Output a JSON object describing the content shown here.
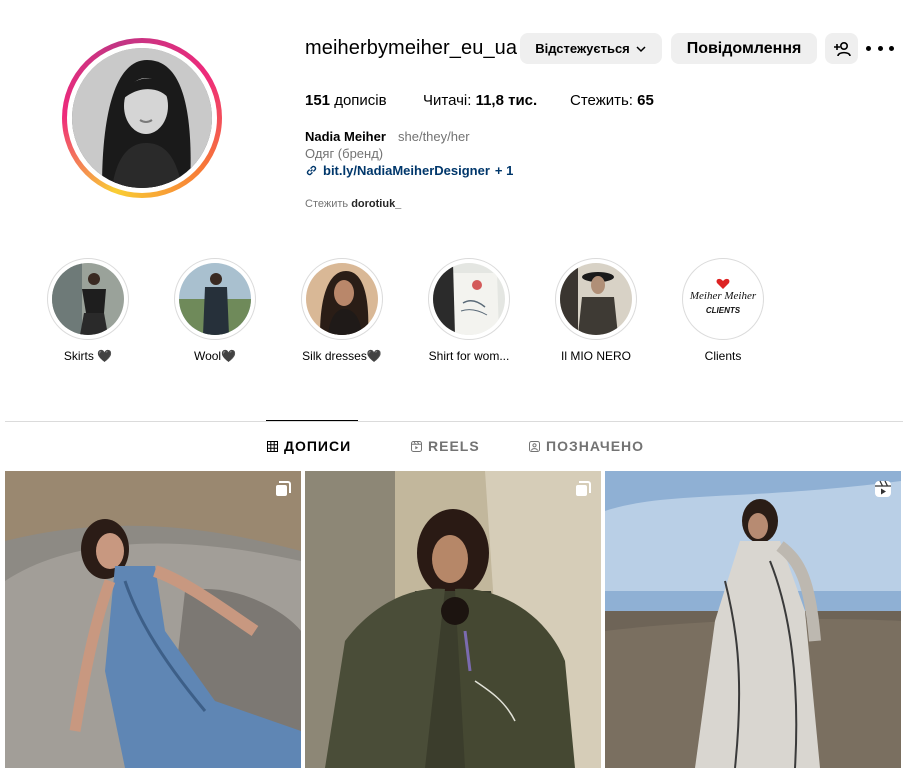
{
  "profile": {
    "username": "meiherbymeiher_eu_ua",
    "follow_button": "Відстежується",
    "message_button": "Повідомлення",
    "posts_count": "151",
    "posts_label": "дописів",
    "followers_label": "Читачі:",
    "followers_count": "11,8 тис.",
    "following_label": "Стежить:",
    "following_count": "65",
    "display_name": "Nadia Meiher",
    "pronouns": "she/they/her",
    "category": "Одяг (бренд)",
    "link_text": "bit.ly/NadiaMeiherDesigner",
    "link_extra": "+ 1",
    "followed_by_label": "Стежить",
    "followed_by_user": "dorotiuk_"
  },
  "highlights": [
    {
      "label": "Skirts 🖤"
    },
    {
      "label": "Wool🖤"
    },
    {
      "label": "Silk dresses🖤"
    },
    {
      "label": "Shirt for wom..."
    },
    {
      "label": "Il MIO NERO"
    },
    {
      "label": "Clients",
      "logo_text": "MeiherMeiher",
      "logo_sub": "CLIENTS"
    }
  ],
  "tabs": [
    {
      "label": "ДОПИСИ",
      "icon": "grid-icon",
      "active": true
    },
    {
      "label": "REELS",
      "icon": "reels-icon",
      "active": false
    },
    {
      "label": "ПОЗНАЧЕНО",
      "icon": "tagged-icon",
      "active": false
    }
  ],
  "posts": [
    {
      "type": "carousel",
      "icon": "carousel-icon"
    },
    {
      "type": "carousel",
      "icon": "carousel-icon"
    },
    {
      "type": "reel",
      "icon": "reel-icon"
    }
  ],
  "colors": {
    "link": "#00376b",
    "secondary_text": "#737373",
    "button_bg": "#efefef",
    "story_ring_start": "#f9ce34",
    "story_ring_end": "#c13584"
  }
}
